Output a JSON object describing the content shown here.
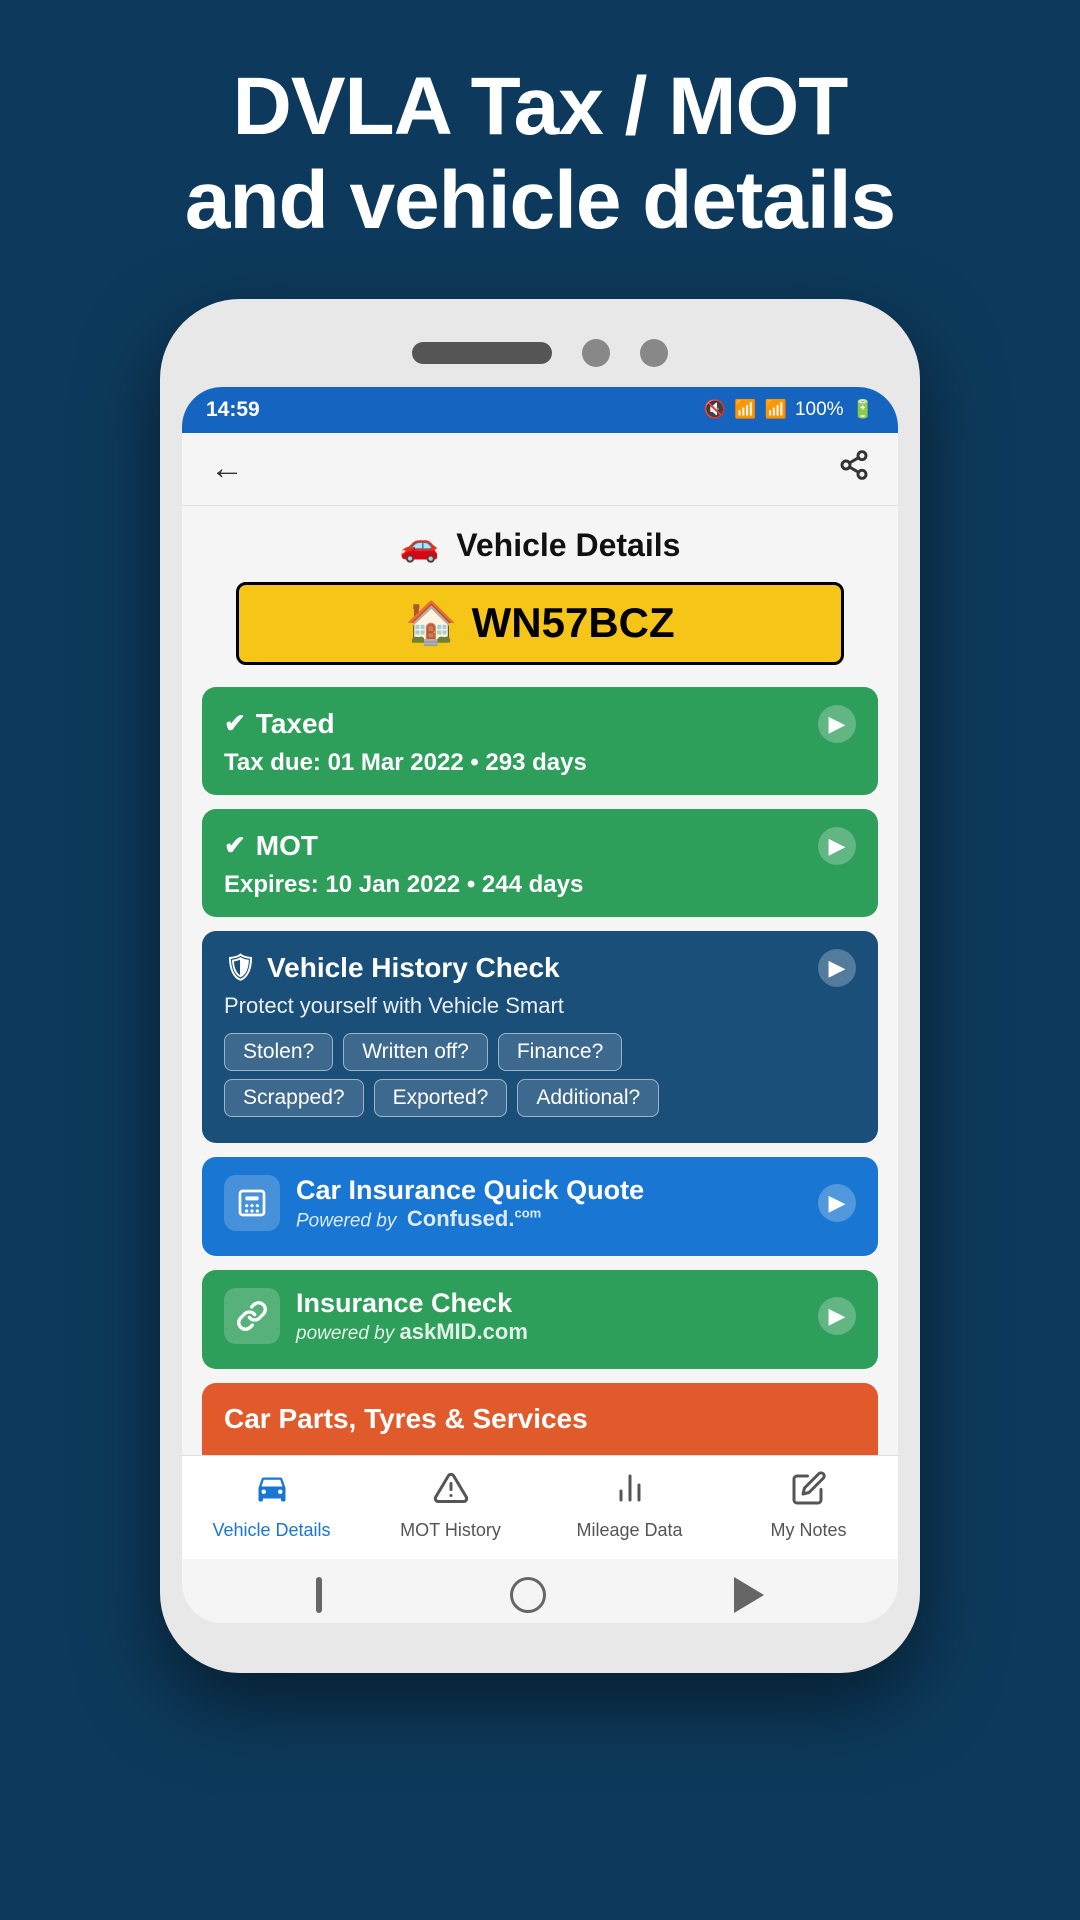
{
  "page": {
    "header_line1": "DVLA Tax / MOT",
    "header_line2": "and vehicle details"
  },
  "status_bar": {
    "time": "14:59",
    "battery": "100%"
  },
  "toolbar": {
    "back_label": "←",
    "share_label": "⋮"
  },
  "vehicle": {
    "title": "Vehicle Details",
    "plate": "WN57BCZ"
  },
  "taxed_card": {
    "title": "Taxed",
    "subtitle": "Tax due: 01 Mar 2022 • 293 days"
  },
  "mot_card": {
    "title": "MOT",
    "subtitle": "Expires: 10 Jan 2022 • 244 days"
  },
  "history_card": {
    "title": "Vehicle History Check",
    "subtitle": "Protect yourself with Vehicle Smart",
    "badges": [
      "Stolen?",
      "Written off?",
      "Finance?",
      "Scrapped?",
      "Exported?",
      "Additional?"
    ]
  },
  "insurance_quote_card": {
    "title": "Car Insurance Quick Quote",
    "powered_by": "Powered by",
    "brand": "Confused.",
    "brand_suffix": "com"
  },
  "insurance_check_card": {
    "title": "Insurance Check",
    "powered_by": "powered by",
    "brand": "askMID.com"
  },
  "car_parts_card": {
    "title": "Car Parts, Tyres & Services"
  },
  "bottom_nav": {
    "items": [
      {
        "label": "Vehicle Details",
        "active": true,
        "icon": "car"
      },
      {
        "label": "MOT History",
        "active": false,
        "icon": "triangle"
      },
      {
        "label": "Mileage Data",
        "active": false,
        "icon": "bar-chart"
      },
      {
        "label": "My Notes",
        "active": false,
        "icon": "pencil"
      }
    ]
  }
}
